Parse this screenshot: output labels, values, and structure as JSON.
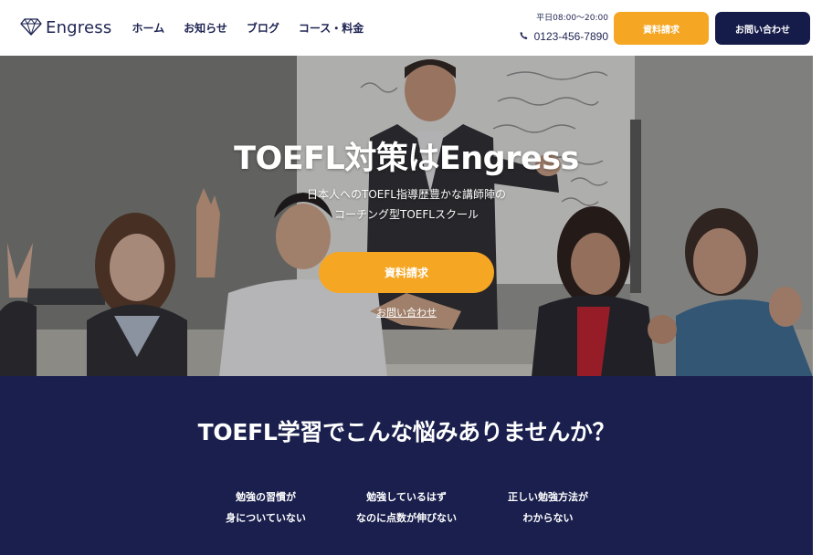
{
  "brand": {
    "name": "Engress",
    "icon": "diamond-icon"
  },
  "nav": {
    "items": [
      {
        "label": "ホーム"
      },
      {
        "label": "お知らせ"
      },
      {
        "label": "ブログ"
      },
      {
        "label": "コース・料金"
      }
    ]
  },
  "contact": {
    "hours": "平日08:00〜20:00",
    "phone": "0123-456-7890",
    "phone_icon": "phone-icon"
  },
  "header_buttons": {
    "docs": "資料請求",
    "inquiry": "お問い合わせ"
  },
  "hero": {
    "title": "TOEFL対策はEngress",
    "subtitle_line1": "日本人へのTOEFL指導歴豊かな講師陣の",
    "subtitle_line2": "コーチング型TOEFLスクール",
    "cta": "資料請求",
    "link": "お問い合わせ"
  },
  "problems": {
    "title": "TOEFL学習でこんな悩みありませんか？",
    "items": [
      {
        "line1": "勉強の習慣が",
        "line2": "身についていない"
      },
      {
        "line1": "勉強しているはず",
        "line2": "なのに点数が伸びない"
      },
      {
        "line1": "正しい勉強方法が",
        "line2": "わからない"
      }
    ]
  },
  "colors": {
    "accent": "#f5a623",
    "navy": "#1a1f4d",
    "brand_text": "#1e2452"
  }
}
